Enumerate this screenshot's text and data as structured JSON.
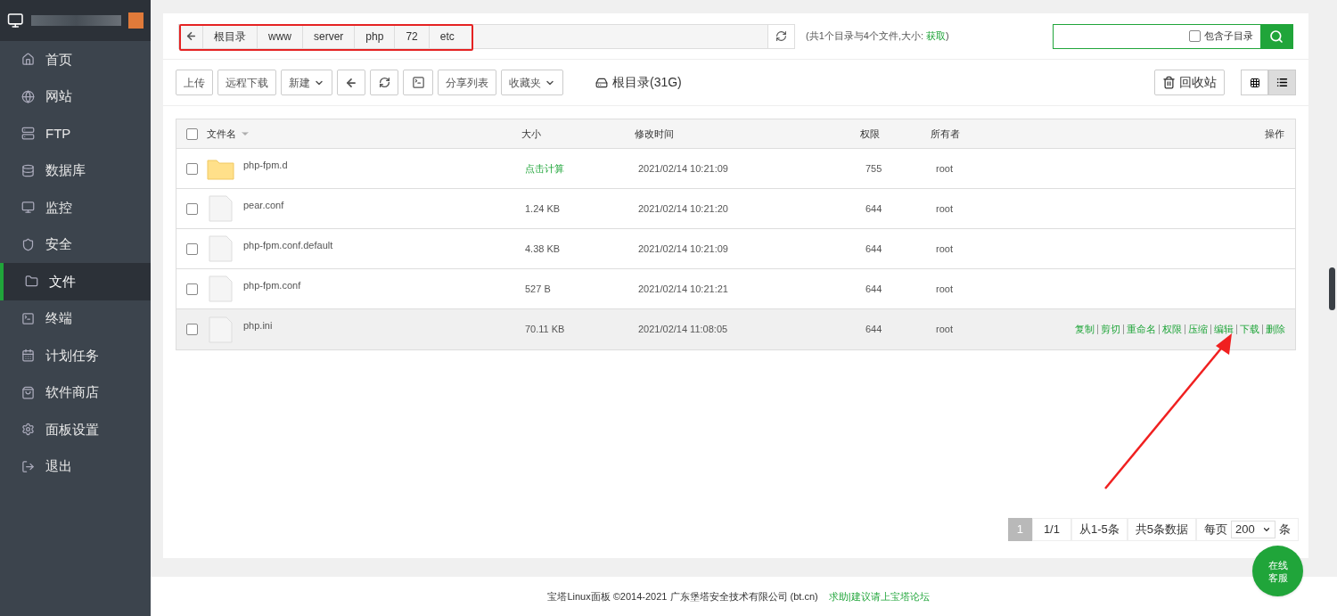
{
  "sidebar": {
    "items": [
      {
        "label": "首页",
        "selected": false
      },
      {
        "label": "网站",
        "selected": false
      },
      {
        "label": "FTP",
        "selected": false
      },
      {
        "label": "数据库",
        "selected": false
      },
      {
        "label": "监控",
        "selected": false
      },
      {
        "label": "安全",
        "selected": false
      },
      {
        "label": "文件",
        "selected": true
      },
      {
        "label": "终端",
        "selected": false
      },
      {
        "label": "计划任务",
        "selected": false
      },
      {
        "label": "软件商店",
        "selected": false
      },
      {
        "label": "面板设置",
        "selected": false
      },
      {
        "label": "退出",
        "selected": false
      }
    ]
  },
  "breadcrumb": [
    "根目录",
    "www",
    "server",
    "php",
    "72",
    "etc"
  ],
  "dir_info": {
    "text": "(共1个目录与4个文件,大小:",
    "link": "获取",
    "close": ")"
  },
  "search": {
    "checkbox_label": "包含子目录",
    "checked": false
  },
  "toolbar": {
    "buttons": [
      {
        "kind": "text",
        "label": "上传"
      },
      {
        "kind": "text",
        "label": "远程下载"
      },
      {
        "kind": "dropdown",
        "label": "新建"
      },
      {
        "kind": "back"
      },
      {
        "kind": "refresh"
      },
      {
        "kind": "terminal"
      },
      {
        "kind": "text",
        "label": "分享列表"
      },
      {
        "kind": "dropdown",
        "label": "收藏夹"
      }
    ],
    "disk": "根目录(31G)",
    "recycle": "回收站",
    "views": [
      {
        "kind": "grid",
        "selected": false
      },
      {
        "kind": "list",
        "selected": true
      }
    ]
  },
  "table": {
    "all_checked": false,
    "columns": [
      "文件名",
      "大小",
      "修改时间",
      "权限",
      "所有者",
      "操作"
    ],
    "rows": [
      {
        "kind": "folder",
        "name": "php-fpm.d",
        "size": "点击计算",
        "size_is_link": true,
        "modified": "2021/02/14 10:21:09",
        "perm": "755",
        "owner": "root",
        "checked": false,
        "highlighted": false
      },
      {
        "kind": "file",
        "name": "pear.conf",
        "size": "1.24 KB",
        "size_is_link": false,
        "modified": "2021/02/14 10:21:20",
        "perm": "644",
        "owner": "root",
        "checked": false,
        "highlighted": false
      },
      {
        "kind": "file",
        "name": "php-fpm.conf.default",
        "size": "4.38 KB",
        "size_is_link": false,
        "modified": "2021/02/14 10:21:09",
        "perm": "644",
        "owner": "root",
        "checked": false,
        "highlighted": false
      },
      {
        "kind": "file",
        "name": "php-fpm.conf",
        "size": "527 B",
        "size_is_link": false,
        "modified": "2021/02/14 10:21:21",
        "perm": "644",
        "owner": "root",
        "checked": false,
        "highlighted": false
      },
      {
        "kind": "file",
        "name": "php.ini",
        "size": "70.11 KB",
        "size_is_link": false,
        "modified": "2021/02/14 11:08:05",
        "perm": "644",
        "owner": "root",
        "checked": false,
        "highlighted": true,
        "actions": [
          "复制",
          "剪切",
          "重命名",
          "权限",
          "压缩",
          "编辑",
          "下载",
          "删除"
        ]
      }
    ]
  },
  "pagination": {
    "page": "1",
    "pages": "1/1",
    "range": "从1-5条",
    "total": "共5条数据",
    "per_page_label": "每页",
    "per_page": "200",
    "unit": "条"
  },
  "footer": {
    "text": "宝塔Linux面板 ©2014-2021 广东堡塔安全技术有限公司 (bt.cn)",
    "link": "求助|建议请上宝塔论坛"
  },
  "chat_button": [
    "在线",
    "客服"
  ]
}
